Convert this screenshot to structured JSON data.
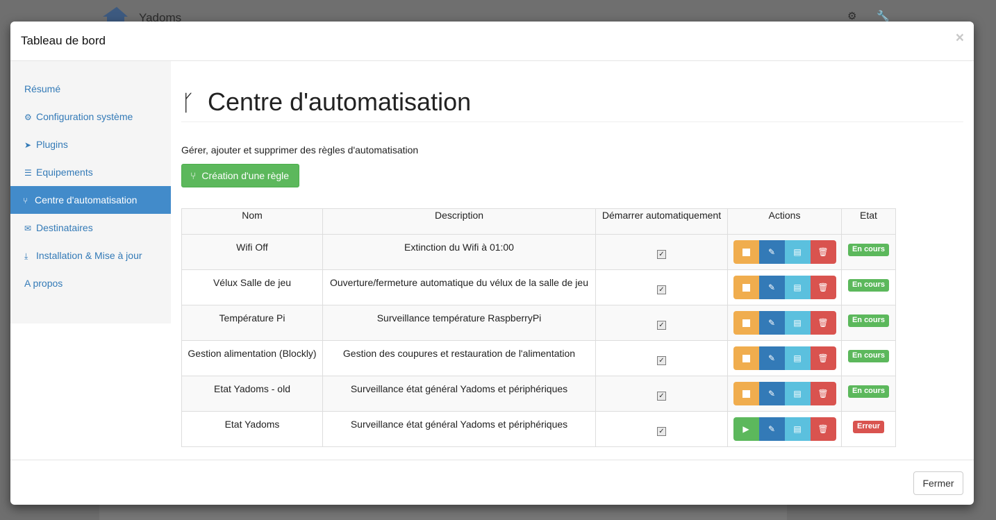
{
  "background": {
    "brand": "Yadoms",
    "icons": [
      "gear-icon",
      "wrench-icon"
    ]
  },
  "modal": {
    "title": "Tableau de bord",
    "close_label": "×",
    "footer_button": "Fermer"
  },
  "sidebar": {
    "items": [
      {
        "label": "Résumé",
        "icon": "",
        "active": false
      },
      {
        "label": "Configuration système",
        "icon": "⚙",
        "active": false
      },
      {
        "label": "Plugins",
        "icon": "➤",
        "active": false
      },
      {
        "label": "Equipements",
        "icon": "☰",
        "active": false
      },
      {
        "label": "Centre d'automatisation",
        "icon": "⑂",
        "active": true
      },
      {
        "label": "Destinataires",
        "icon": "✉",
        "active": false
      },
      {
        "label": "Installation & Mise à jour",
        "icon": "⤓",
        "active": false
      },
      {
        "label": "A propos",
        "icon": "",
        "active": false
      }
    ]
  },
  "main": {
    "title": "Centre d'automatisation",
    "title_icon": "code-fork-icon",
    "description": "Gérer, ajouter et supprimer des règles d'automatisation",
    "create_button": "Création d'une règle"
  },
  "table": {
    "headers": [
      "Nom",
      "Description",
      "Démarrer automatiquement",
      "Actions",
      "Etat"
    ],
    "rows": [
      {
        "name": "Wifi Off",
        "description": "Extinction du Wifi à 01:00",
        "autostart": true,
        "running": true,
        "state": "En cours"
      },
      {
        "name": "Vélux Salle de jeu",
        "description": "Ouverture/fermeture automatique du vélux de la salle de jeu",
        "autostart": true,
        "running": true,
        "state": "En cours"
      },
      {
        "name": "Température Pi",
        "description": "Surveillance température RaspberryPi",
        "autostart": true,
        "running": true,
        "state": "En cours"
      },
      {
        "name": "Gestion alimentation (Blockly)",
        "description": "Gestion des coupures et restauration de l'alimentation",
        "autostart": true,
        "running": true,
        "state": "En cours"
      },
      {
        "name": "Etat Yadoms - old",
        "description": "Surveillance état général Yadoms et périphériques",
        "autostart": true,
        "running": true,
        "state": "En cours"
      },
      {
        "name": "Etat Yadoms",
        "description": "Surveillance état général Yadoms et périphériques",
        "autostart": true,
        "running": false,
        "state": "Erreur"
      }
    ]
  },
  "colors": {
    "success": "#5cb85c",
    "warning": "#f0ad4e",
    "primary": "#337ab7",
    "info": "#5bc0de",
    "danger": "#d9534f",
    "nav_active": "#428bca"
  }
}
